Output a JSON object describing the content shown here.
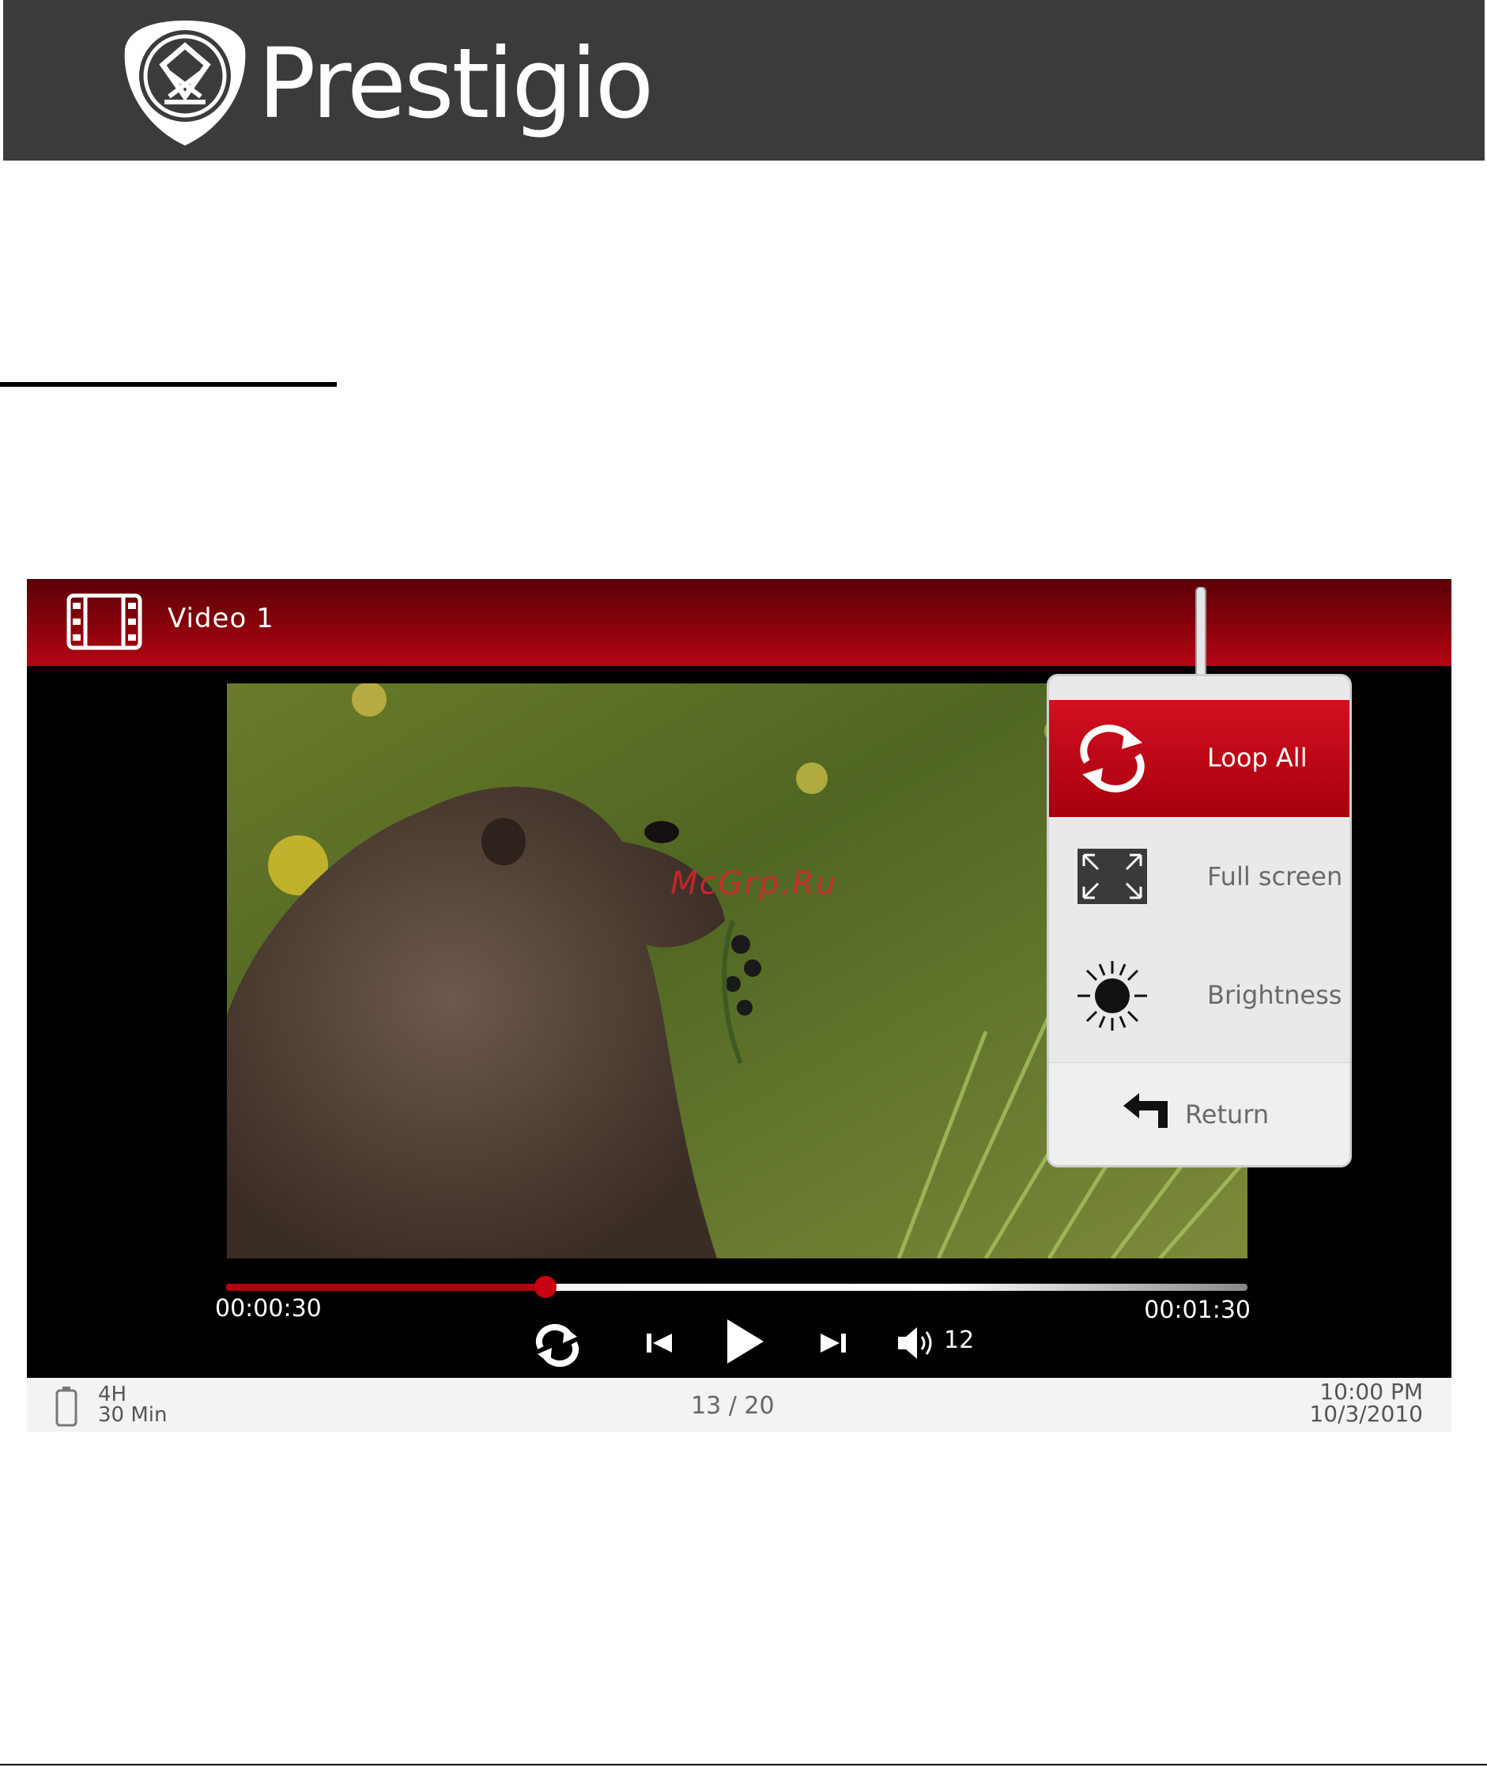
{
  "brand": {
    "logo_text": "Prestigio"
  },
  "player": {
    "title": "Video  1",
    "time_elapsed": "00:00:30",
    "time_total": "00:01:30",
    "progress_fraction": 0.313,
    "volume_level": "12"
  },
  "menu": {
    "items": [
      {
        "label": "Loop  All",
        "icon": "loop-icon",
        "active": true
      },
      {
        "label": "Full screen",
        "icon": "fullscreen-icon",
        "active": false
      },
      {
        "label": "Brightness",
        "icon": "brightness-icon",
        "active": false
      }
    ],
    "return_label": "Return"
  },
  "status": {
    "battery_hours": "4H",
    "battery_minutes": "30 Min",
    "page": "13 / 20",
    "time": "10:00 PM",
    "date": "10/3/2010"
  },
  "watermark": "McGrp.Ru",
  "colors": {
    "accent": "#b30010",
    "banner": "#3b3b3d"
  }
}
